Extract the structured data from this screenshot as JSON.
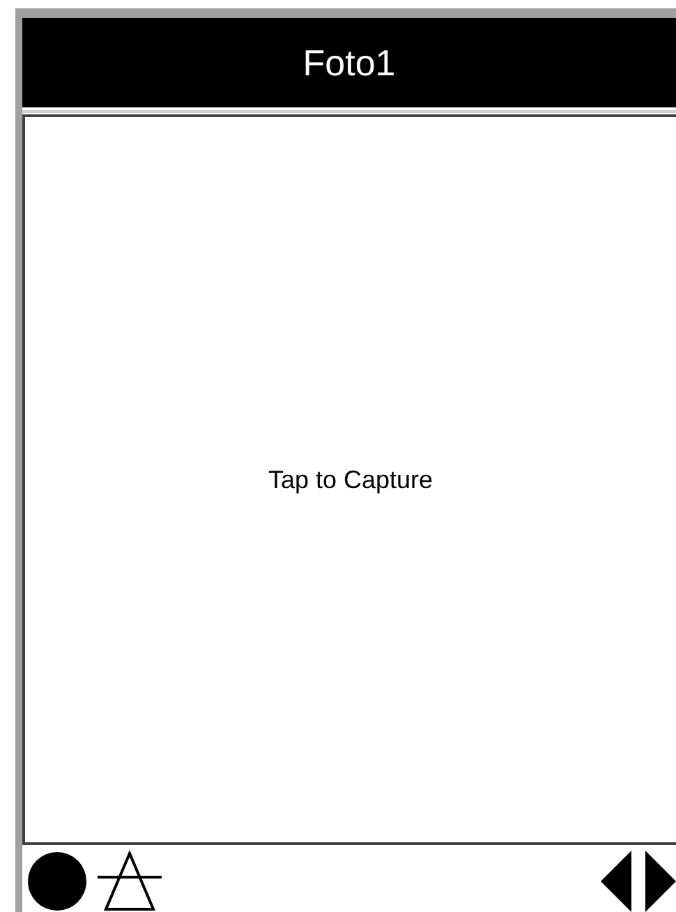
{
  "title": "Foto1",
  "viewfinder": {
    "hint": "Tap to Capture"
  }
}
